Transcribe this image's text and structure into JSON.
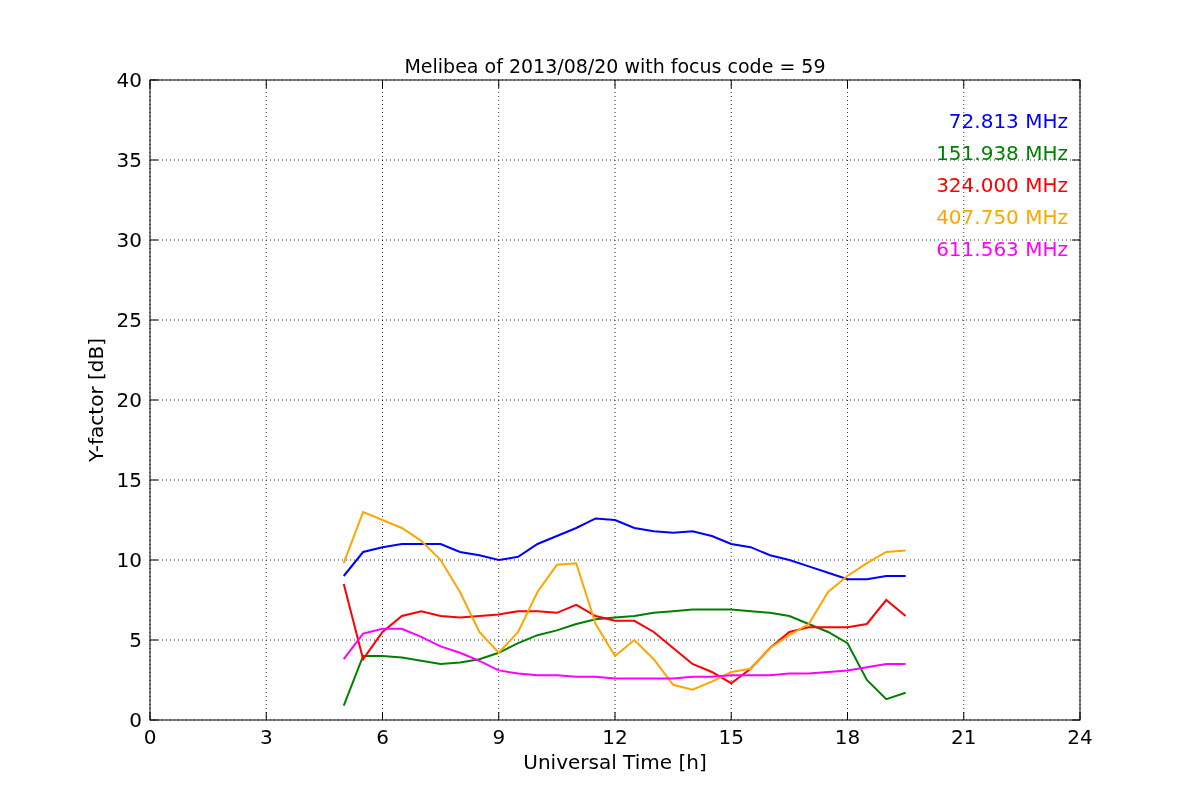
{
  "figure": {
    "chart_data": {
      "type": "line",
      "title": "Melibea of 2013/08/20 with focus code = 59",
      "xlabel": "Universal Time [h]",
      "ylabel": "Y-factor [dB]",
      "x": [
        5,
        5.5,
        6,
        6.5,
        7,
        7.5,
        8,
        8.5,
        9,
        9.5,
        10,
        10.5,
        11,
        11.5,
        12,
        12.5,
        13,
        13.5,
        14,
        14.5,
        15,
        15.5,
        16,
        16.5,
        17,
        17.5,
        18,
        18.5,
        19,
        19.5
      ],
      "series": [
        {
          "name": "72.813 MHz",
          "color": "#0000ff",
          "values": [
            9,
            10.5,
            10.8,
            11,
            11,
            11,
            10.5,
            10.3,
            10,
            10.2,
            11,
            11.5,
            12,
            12.6,
            12.5,
            12,
            11.8,
            11.7,
            11.8,
            11.5,
            11,
            10.8,
            10.3,
            10,
            9.6,
            9.2,
            8.8,
            8.8,
            9,
            9
          ]
        },
        {
          "name": "151.938 MHz",
          "color": "#008000",
          "values": [
            0.9,
            4,
            4,
            3.9,
            3.7,
            3.5,
            3.6,
            3.8,
            4.2,
            4.8,
            5.3,
            5.6,
            6,
            6.3,
            6.4,
            6.5,
            6.7,
            6.8,
            6.9,
            6.9,
            6.9,
            6.8,
            6.7,
            6.5,
            6,
            5.5,
            4.8,
            2.5,
            1.3,
            1.7
          ]
        },
        {
          "name": "324.000 MHz",
          "color": "#ff0000",
          "values": [
            8.5,
            3.8,
            5.5,
            6.5,
            6.8,
            6.5,
            6.4,
            6.5,
            6.6,
            6.8,
            6.8,
            6.7,
            7.2,
            6.5,
            6.2,
            6.2,
            5.5,
            4.5,
            3.5,
            3,
            2.3,
            3.2,
            4.5,
            5.5,
            5.8,
            5.8,
            5.8,
            6,
            7.5,
            6.5
          ]
        },
        {
          "name": "407.750 MHz",
          "color": "#ffa500",
          "values": [
            9.8,
            13,
            12.5,
            12,
            11.2,
            10,
            8,
            5.5,
            4.2,
            5.5,
            8,
            9.7,
            9.8,
            6,
            4,
            5,
            3.8,
            2.2,
            1.9,
            2.4,
            3,
            3.2,
            4.5,
            5.3,
            6,
            8,
            9,
            9.8,
            10.5,
            10.6
          ]
        },
        {
          "name": "611.563 MHz",
          "color": "#ff00ff",
          "values": [
            3.8,
            5.4,
            5.7,
            5.7,
            5.2,
            4.6,
            4.2,
            3.7,
            3.1,
            2.9,
            2.8,
            2.8,
            2.7,
            2.7,
            2.6,
            2.6,
            2.6,
            2.6,
            2.7,
            2.7,
            2.8,
            2.8,
            2.8,
            2.9,
            2.9,
            3,
            3.1,
            3.3,
            3.5,
            3.5
          ]
        }
      ],
      "grid": true,
      "xlim": [
        0,
        24
      ],
      "ylim": [
        0,
        40
      ],
      "xticks": [
        0,
        3,
        6,
        9,
        12,
        15,
        18,
        21,
        24
      ],
      "yticks": [
        0,
        5,
        10,
        15,
        20,
        25,
        30,
        35,
        40
      ]
    }
  }
}
